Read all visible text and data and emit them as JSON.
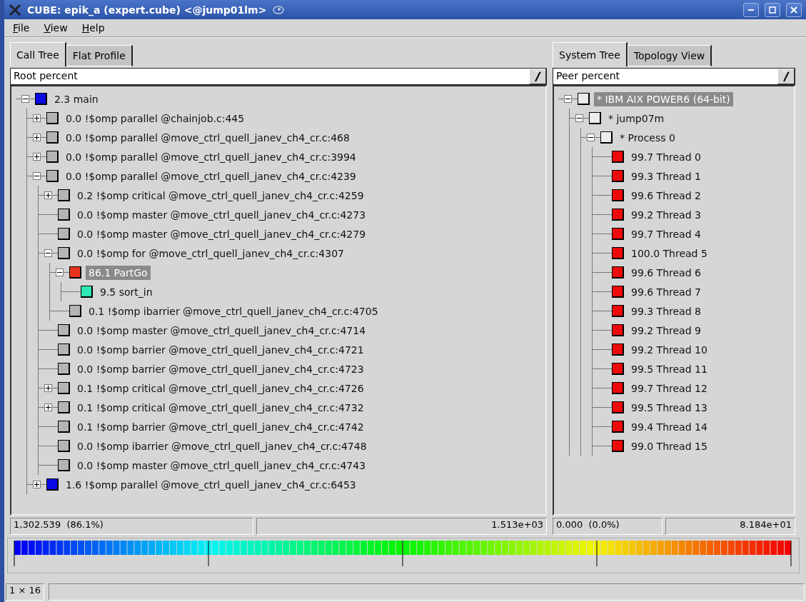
{
  "window": {
    "title": "CUBE: epik_a (expert.cube) <@jump01lm>"
  },
  "menu": [
    "File",
    "View",
    "Help"
  ],
  "call_panel": {
    "tabs": [
      {
        "label": "Call Tree",
        "selected": true
      },
      {
        "label": "Flat Profile",
        "selected": false
      }
    ],
    "metric": "Root percent",
    "tree": [
      {
        "label": "2.3 main",
        "color": "#0a0ae6",
        "expanded": true,
        "selected": false,
        "children": [
          {
            "label": "0.0 !$omp parallel @chainjob.c:445",
            "color": "#b4b4b4",
            "expanded": false,
            "selected": false
          },
          {
            "label": "0.0 !$omp parallel @move_ctrl_quell_janev_ch4_cr.c:468",
            "color": "#b4b4b4",
            "expanded": false,
            "selected": false
          },
          {
            "label": "0.0 !$omp parallel @move_ctrl_quell_janev_ch4_cr.c:3994",
            "color": "#b4b4b4",
            "expanded": false,
            "selected": false
          },
          {
            "label": "0.0 !$omp parallel @move_ctrl_quell_janev_ch4_cr.c:4239",
            "color": "#b4b4b4",
            "expanded": true,
            "selected": false,
            "children": [
              {
                "label": "0.2 !$omp critical @move_ctrl_quell_janev_ch4_cr.c:4259",
                "color": "#b4b4b4",
                "expanded": false,
                "selected": false
              },
              {
                "label": "0.0 !$omp master @move_ctrl_quell_janev_ch4_cr.c:4273",
                "color": "#b4b4b4",
                "selected": false
              },
              {
                "label": "0.0 !$omp master @move_ctrl_quell_janev_ch4_cr.c:4279",
                "color": "#b4b4b4",
                "selected": false
              },
              {
                "label": "0.0 !$omp for @move_ctrl_quell_janev_ch4_cr.c:4307",
                "color": "#b4b4b4",
                "expanded": true,
                "selected": false,
                "children": [
                  {
                    "label": "86.1 PartGo",
                    "color": "#e8341c",
                    "expanded": true,
                    "selected": true,
                    "children": [
                      {
                        "label": "9.5 sort_in",
                        "color": "#30e8b4",
                        "selected": false
                      }
                    ]
                  },
                  {
                    "label": "0.1 !$omp ibarrier @move_ctrl_quell_janev_ch4_cr.c:4705",
                    "color": "#b4b4b4",
                    "selected": false
                  }
                ]
              },
              {
                "label": "0.0 !$omp master @move_ctrl_quell_janev_ch4_cr.c:4714",
                "color": "#b4b4b4",
                "selected": false
              },
              {
                "label": "0.0 !$omp barrier @move_ctrl_quell_janev_ch4_cr.c:4721",
                "color": "#b4b4b4",
                "selected": false
              },
              {
                "label": "0.0 !$omp barrier @move_ctrl_quell_janev_ch4_cr.c:4723",
                "color": "#b4b4b4",
                "selected": false
              },
              {
                "label": "0.1 !$omp critical @move_ctrl_quell_janev_ch4_cr.c:4726",
                "color": "#b4b4b4",
                "expanded": false,
                "selected": false
              },
              {
                "label": "0.1 !$omp critical @move_ctrl_quell_janev_ch4_cr.c:4732",
                "color": "#b4b4b4",
                "expanded": false,
                "selected": false
              },
              {
                "label": "0.1 !$omp barrier @move_ctrl_quell_janev_ch4_cr.c:4742",
                "color": "#b4b4b4",
                "selected": false
              },
              {
                "label": "0.0 !$omp ibarrier @move_ctrl_quell_janev_ch4_cr.c:4748",
                "color": "#b4b4b4",
                "selected": false
              },
              {
                "label": "0.0 !$omp master @move_ctrl_quell_janev_ch4_cr.c:4743",
                "color": "#b4b4b4",
                "selected": false
              }
            ]
          },
          {
            "label": "1.6 !$omp parallel @move_ctrl_quell_janev_ch4_cr.c:6453",
            "color": "#0a0ae6",
            "expanded": false,
            "selected": false
          }
        ]
      }
    ],
    "status": {
      "value": "1,302.539  (86.1%)",
      "max": "1.513e+03"
    }
  },
  "system_panel": {
    "tabs": [
      {
        "label": "System Tree",
        "selected": true
      },
      {
        "label": "Topology View",
        "selected": false
      }
    ],
    "metric": "Peer percent",
    "tree": [
      {
        "label": "* IBM AIX POWER6 (64-bit)",
        "color": "#ececec",
        "expanded": true,
        "selected": true,
        "children": [
          {
            "label": "* jump07m",
            "color": "#ececec",
            "expanded": true,
            "selected": false,
            "children": [
              {
                "label": "* Process 0",
                "color": "#ececec",
                "expanded": true,
                "selected": false,
                "children": [
                  {
                    "label": "99.7 Thread 0",
                    "color": "#ee0a0a",
                    "selected": false
                  },
                  {
                    "label": "99.3 Thread 1",
                    "color": "#ee0a0a",
                    "selected": false
                  },
                  {
                    "label": "99.6 Thread 2",
                    "color": "#ee0a0a",
                    "selected": false
                  },
                  {
                    "label": "99.2 Thread 3",
                    "color": "#ee0a0a",
                    "selected": false
                  },
                  {
                    "label": "99.7 Thread 4",
                    "color": "#ee0a0a",
                    "selected": false
                  },
                  {
                    "label": "100.0 Thread 5",
                    "color": "#ee0a0a",
                    "selected": false
                  },
                  {
                    "label": "99.6 Thread 6",
                    "color": "#ee0a0a",
                    "selected": false
                  },
                  {
                    "label": "99.6 Thread 7",
                    "color": "#ee0a0a",
                    "selected": false
                  },
                  {
                    "label": "99.3 Thread 8",
                    "color": "#ee0a0a",
                    "selected": false
                  },
                  {
                    "label": "99.2 Thread 9",
                    "color": "#ee0a0a",
                    "selected": false
                  },
                  {
                    "label": "99.2 Thread 10",
                    "color": "#ee0a0a",
                    "selected": false
                  },
                  {
                    "label": "99.5 Thread 11",
                    "color": "#ee0a0a",
                    "selected": false
                  },
                  {
                    "label": "99.7 Thread 12",
                    "color": "#ee0a0a",
                    "selected": false
                  },
                  {
                    "label": "99.5 Thread 13",
                    "color": "#ee0a0a",
                    "selected": false
                  },
                  {
                    "label": "99.4 Thread 14",
                    "color": "#ee0a0a",
                    "selected": false
                  },
                  {
                    "label": "99.0 Thread 15",
                    "color": "#ee0a0a",
                    "selected": false
                  }
                ]
              }
            ]
          }
        ]
      }
    ],
    "status": {
      "value": "0.000  (0.0%)",
      "max": "8.184e+01"
    }
  },
  "status_bar": {
    "dimensions": "1 × 16"
  }
}
